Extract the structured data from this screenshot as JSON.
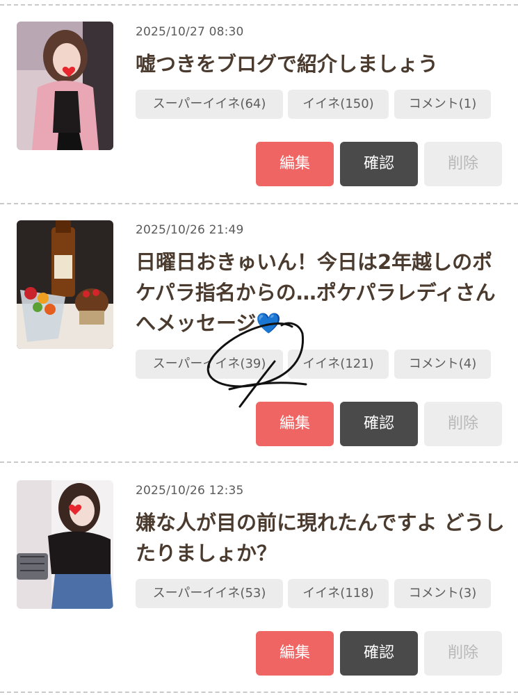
{
  "posts": [
    {
      "date": "2025/10/27 08:30",
      "title": "嘘つきをブログで紹介しましょう",
      "super_like": "スーパーイイネ(64)",
      "like": "イイネ(150)",
      "comment": "コメント(1)",
      "edit": "編集",
      "confirm": "確認",
      "delete": "削除"
    },
    {
      "date": "2025/10/26 21:49",
      "title": "日曜日おきゅいん！今日は2年越しのポケパラ指名からの…ポケパラレディさんへメッセージ💙",
      "super_like": "スーパーイイネ(39)",
      "like": "イイネ(121)",
      "comment": "コメント(4)",
      "edit": "編集",
      "confirm": "確認",
      "delete": "削除"
    },
    {
      "date": "2025/10/26 12:35",
      "title": "嫌な人が目の前に現れたんですよ どうしたりましょか？",
      "super_like": "スーパーイイネ(53)",
      "like": "イイネ(118)",
      "comment": "コメント(3)",
      "edit": "編集",
      "confirm": "確認",
      "delete": "削除"
    }
  ],
  "colors": {
    "edit_button": "#ef6563",
    "confirm_button": "#4a4a4a",
    "delete_button": "#ededed",
    "chip": "#ececec",
    "title_text": "#4a3b2e"
  }
}
